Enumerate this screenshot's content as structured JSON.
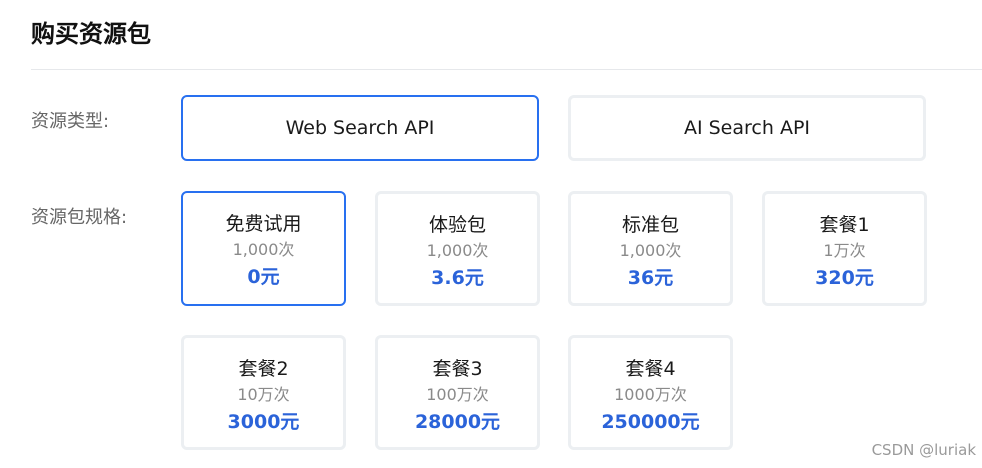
{
  "page_title": "购买资源包",
  "resource_type": {
    "label": "资源类型:",
    "options": [
      "Web Search API",
      "AI Search API"
    ],
    "selected": "Web Search API"
  },
  "package_spec": {
    "label": "资源包规格:",
    "selected": "免费试用",
    "packages": [
      {
        "name": "免费试用",
        "count": "1,000次",
        "price": "0元"
      },
      {
        "name": "体验包",
        "count": "1,000次",
        "price": "3.6元"
      },
      {
        "name": "标准包",
        "count": "1,000次",
        "price": "36元"
      },
      {
        "name": "套餐1",
        "count": "1万次",
        "price": "320元"
      },
      {
        "name": "套餐2",
        "count": "10万次",
        "price": "3000元"
      },
      {
        "name": "套餐3",
        "count": "100万次",
        "price": "28000元"
      },
      {
        "name": "套餐4",
        "count": "1000万次",
        "price": "250000元"
      }
    ]
  },
  "colors": {
    "accent": "#2870f0",
    "price": "#2b63d9"
  },
  "watermark": "CSDN @luriak"
}
